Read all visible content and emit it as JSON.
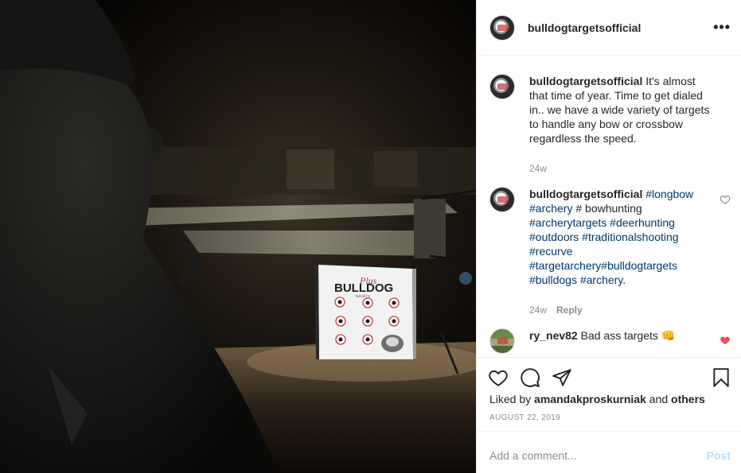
{
  "header": {
    "username": "bulldogtargetsofficial",
    "more": "•••"
  },
  "photo": {
    "target_brand_script": "Plus",
    "target_brand": "BULLDOG",
    "target_sub": "TARGETS"
  },
  "comments": [
    {
      "username": "bulldogtargetsofficial",
      "text": "It's almost that time of year. Time to get dialed in.. we have a wide variety of targets to handle any bow or crossbow regardless the speed.",
      "time": "24w"
    },
    {
      "username": "bulldogtargetsofficial",
      "parts": [
        {
          "t": "#longbow",
          "tag": true
        },
        {
          "t": " ",
          "tag": false
        },
        {
          "t": "#archery",
          "tag": true
        },
        {
          "t": " # bowhunting ",
          "tag": false
        },
        {
          "t": "#archerytargets",
          "tag": true
        },
        {
          "t": " ",
          "tag": false
        },
        {
          "t": "#deerhunting",
          "tag": true
        },
        {
          "t": " ",
          "tag": false
        },
        {
          "t": "#outdoors",
          "tag": true
        },
        {
          "t": " ",
          "tag": false
        },
        {
          "t": "#traditionalshooting",
          "tag": true
        },
        {
          "t": " ",
          "tag": false
        },
        {
          "t": "#recurve",
          "tag": true
        },
        {
          "t": " ",
          "tag": false
        },
        {
          "t": "#targetarchery",
          "tag": true
        },
        {
          "t": "#bulldogtargets",
          "tag": true
        },
        {
          "t": " ",
          "tag": false
        },
        {
          "t": "#bulldogs",
          "tag": true
        },
        {
          "t": " ",
          "tag": false
        },
        {
          "t": "#archery",
          "tag": true
        },
        {
          "t": ".",
          "tag": false
        }
      ],
      "time": "24w",
      "reply": "Reply"
    },
    {
      "username": "ry_nev82",
      "text": "Bad ass targets 👊"
    }
  ],
  "likes": {
    "prefix": "Liked by ",
    "user": "amandakproskurniak",
    "mid": " and ",
    "others": "others"
  },
  "date": "AUGUST 22, 2019",
  "add_comment": {
    "placeholder": "Add a comment...",
    "post": "Post"
  },
  "colors": {
    "like_red": "#ed4956",
    "hashtag": "#00376b",
    "post_disabled": "#b2dffc"
  },
  "icons": [
    "more-icon",
    "heart-icon",
    "comment-icon",
    "share-icon",
    "bookmark-icon",
    "small-heart-icon"
  ]
}
